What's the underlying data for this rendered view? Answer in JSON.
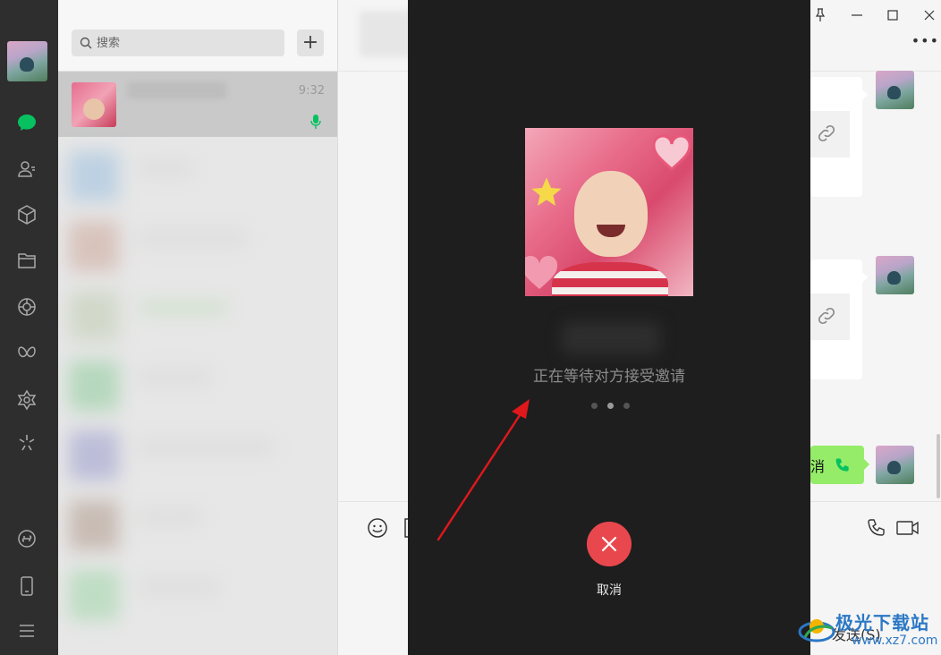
{
  "sidebar": {
    "icons": [
      "avatar",
      "chat-icon",
      "contacts-icon",
      "collections-icon",
      "files-icon",
      "moments-icon",
      "channels-icon",
      "discover-icon",
      "miniprogram-icon",
      "mini-app-icon",
      "phone-icon",
      "menu-icon"
    ]
  },
  "search": {
    "placeholder": "搜索",
    "add_label": "+"
  },
  "chat_list": {
    "selected": {
      "time": "9:32"
    }
  },
  "conversation": {
    "green_bubble_text": "消",
    "send_label": "发送(S)"
  },
  "call": {
    "status": "正在等待对方接受邀请",
    "cancel_label": "取消"
  },
  "watermark": {
    "title": "极光下载站",
    "url": "www.xz7.com"
  },
  "colors": {
    "rail_bg": "#2e2e2e",
    "call_bg": "#1e1e1e",
    "cancel_red": "#e8484d",
    "wechat_green": "#07c160",
    "bubble_green": "#95ec69",
    "arrow_red": "#e0181c",
    "watermark_blue": "#2b78c5"
  }
}
